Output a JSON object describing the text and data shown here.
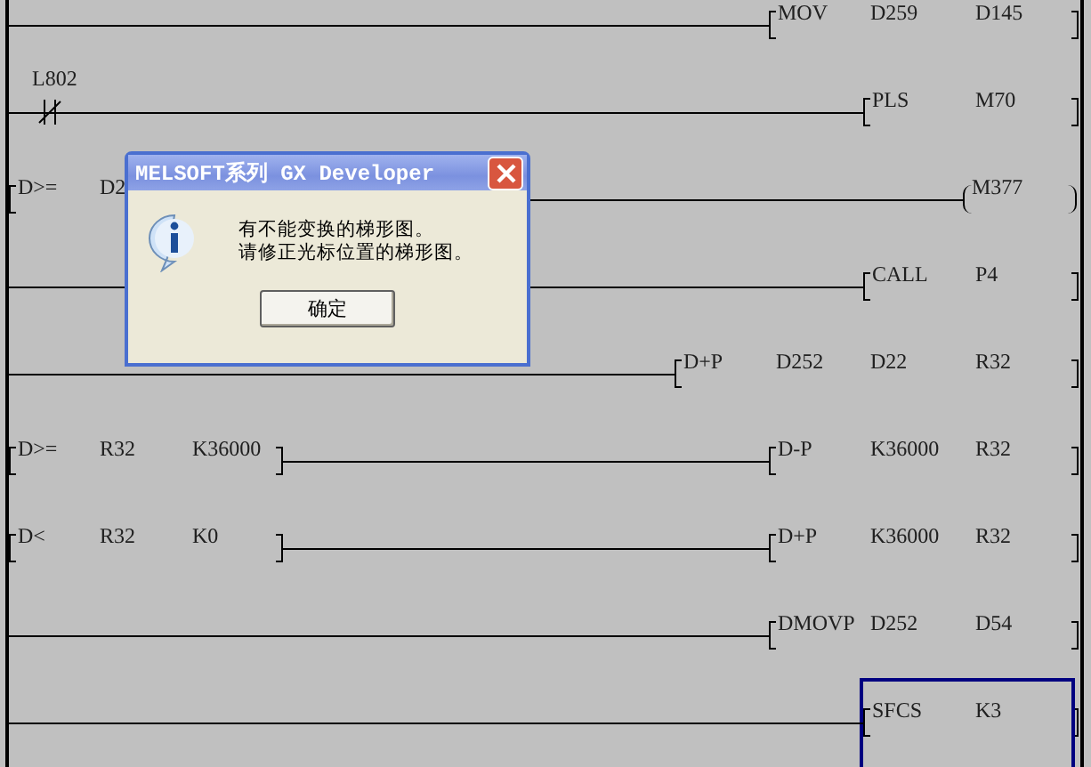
{
  "rungs": [
    {
      "selected": false,
      "right": {
        "kind": "instruction",
        "tokens": [
          "MOV",
          "D259",
          "D145"
        ]
      }
    },
    {
      "selected": false,
      "left": {
        "kind": "nc-contact",
        "tokens": [
          "L802"
        ]
      },
      "right": {
        "kind": "instruction",
        "tokens": [
          "PLS",
          "M70"
        ]
      }
    },
    {
      "selected": false,
      "left": {
        "kind": "compare",
        "tokens": [
          "D>=",
          "D2"
        ]
      },
      "right": {
        "kind": "coil",
        "tokens": [
          "M377"
        ]
      }
    },
    {
      "selected": false,
      "right": {
        "kind": "instruction",
        "tokens": [
          "CALL",
          "P4"
        ]
      }
    },
    {
      "selected": false,
      "right": {
        "kind": "instruction",
        "tokens": [
          "D+P",
          "D252",
          "D22",
          "R32"
        ]
      }
    },
    {
      "selected": false,
      "left": {
        "kind": "compare",
        "tokens": [
          "D>=",
          "R32",
          "K36000"
        ]
      },
      "right": {
        "kind": "instruction",
        "tokens": [
          "D-P",
          "K36000",
          "R32"
        ]
      }
    },
    {
      "selected": false,
      "left": {
        "kind": "compare",
        "tokens": [
          "D<",
          "R32",
          "K0"
        ]
      },
      "right": {
        "kind": "instruction",
        "tokens": [
          "D+P",
          "K36000",
          "R32"
        ]
      }
    },
    {
      "selected": false,
      "right": {
        "kind": "instruction",
        "tokens": [
          "DMOVP",
          "D252",
          "D54"
        ]
      }
    },
    {
      "selected": true,
      "right": {
        "kind": "instruction",
        "tokens": [
          "SFCS",
          "K3"
        ]
      }
    }
  ],
  "dialog": {
    "title": "MELSOFT系列 GX Developer",
    "message_lines": [
      "有不能变换的梯形图。",
      "请修正光标位置的梯形图。"
    ],
    "button": "确定"
  }
}
